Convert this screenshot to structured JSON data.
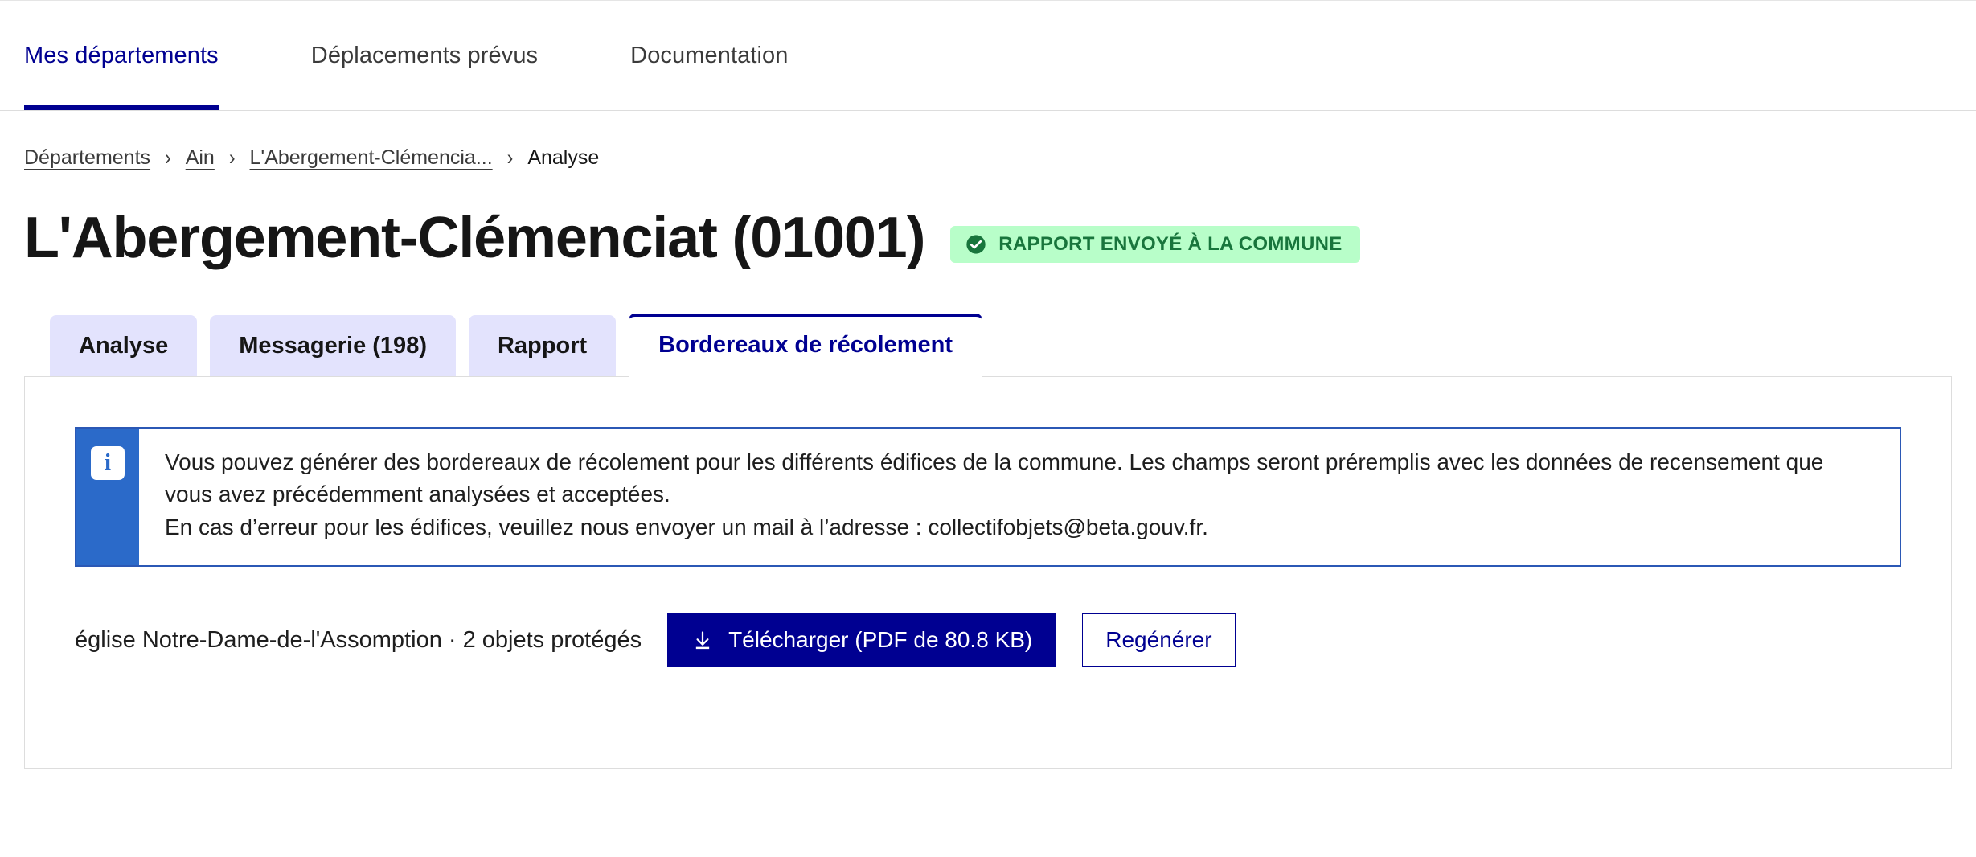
{
  "header": {
    "nav_items": [
      {
        "label": "Mes départements",
        "active": true
      },
      {
        "label": "Déplacements prévus",
        "active": false
      },
      {
        "label": "Documentation",
        "active": false
      }
    ]
  },
  "breadcrumb": {
    "items": [
      {
        "label": "Départements",
        "link": true
      },
      {
        "label": "Ain",
        "link": true
      },
      {
        "label": "L'Abergement-Clémencia...",
        "link": true
      },
      {
        "label": "Analyse",
        "link": false
      }
    ],
    "separator": "›"
  },
  "page": {
    "title": "L'Abergement-Clémenciat (01001)",
    "status_badge": {
      "label": "RAPPORT ENVOYÉ À LA COMMUNE",
      "icon": "check-circle-icon",
      "bg_color": "#b8fec9",
      "text_color": "#18753c"
    }
  },
  "tabs": [
    {
      "label": "Analyse",
      "active": false
    },
    {
      "label": "Messagerie (198)",
      "active": false
    },
    {
      "label": "Rapport",
      "active": false
    },
    {
      "label": "Bordereaux de récolement",
      "active": true
    }
  ],
  "callout": {
    "icon": "info-icon",
    "bar_color": "#2b6ac9",
    "border_color": "#2b58b5",
    "line1": "Vous pouvez générer des bordereaux de récolement pour les différents édifices de la commune. Les champs seront préremplis avec les données de recensement que vous avez précédemment analysées et acceptées.",
    "line2": "En cas d’erreur pour les édifices, veuillez nous envoyer un mail à l’adresse : collectifobjets@beta.gouv.fr."
  },
  "action_row": {
    "edifice_label": "église Notre-Dame-de-l'Assomption · 2 objets protégés",
    "download_button": {
      "label": "Télécharger (PDF de 80.8 KB)",
      "icon": "download-icon",
      "bg_color": "#000091"
    },
    "regenerate_button": {
      "label": "Regénérer",
      "text_color": "#000091"
    }
  }
}
